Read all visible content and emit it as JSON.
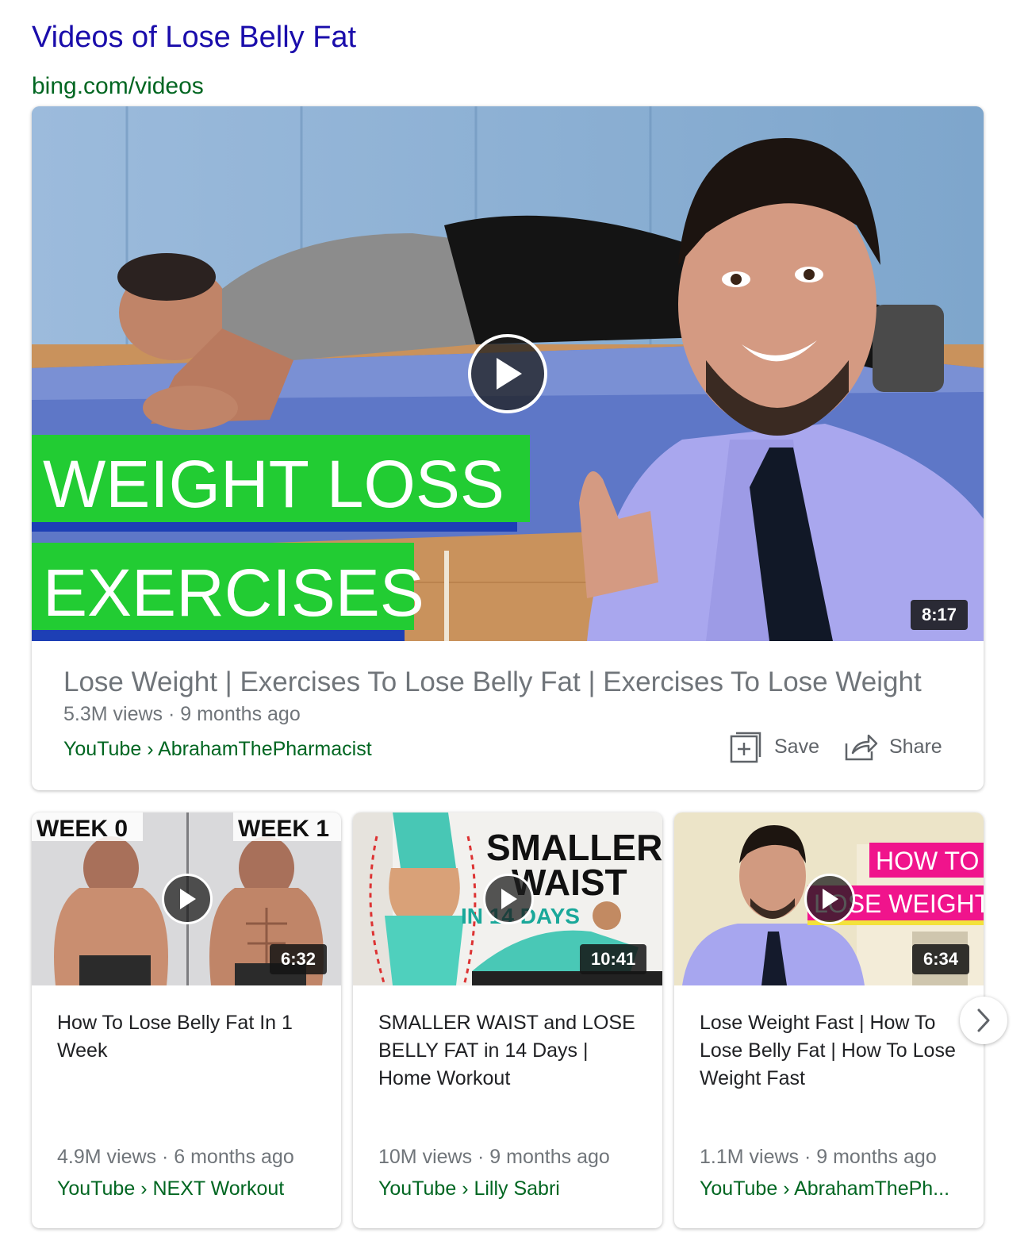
{
  "header": {
    "title": "Videos of Lose Belly Fat",
    "source": "bing.com/videos"
  },
  "featured": {
    "overlay_line1": "WEIGHT LOSS",
    "overlay_line2": "EXERCISES",
    "duration": "8:17",
    "title": "Lose Weight | Exercises To Lose Belly Fat | Exercises To Lose Weight",
    "meta": "5.3M views · 9 months ago",
    "source": "YouTube › AbrahamThePharmacist",
    "save_label": "Save",
    "share_label": "Share"
  },
  "videos": [
    {
      "overlay_left": "WEEK 0",
      "overlay_right": "WEEK 1",
      "duration": "6:32",
      "title": "How To Lose Belly Fat In 1 Week",
      "meta": "4.9M views · 6 months ago",
      "source": "YouTube › NEXT Workout"
    },
    {
      "overlay_line1": "SMALLER",
      "overlay_line2": "WAIST",
      "overlay_line3": "IN 14 DAYS",
      "duration": "10:41",
      "title": "SMALLER WAIST and LOSE BELLY FAT in 14 Days | Home Workout",
      "meta": "10M views · 9 months ago",
      "source": "YouTube › Lilly Sabri"
    },
    {
      "overlay_line1": "HOW TO",
      "overlay_line2": "LOSE WEIGHT",
      "duration": "6:34",
      "title": "Lose Weight Fast | How To Lose Belly Fat | How To Lose Weight Fast",
      "meta": "1.1M views · 9 months ago",
      "source": "YouTube › AbrahamThePh..."
    }
  ],
  "colors": {
    "link": "#1a0dab",
    "source_green": "#006621",
    "meta_gray": "#70757a",
    "overlay_green": "#22cc33",
    "overlay_pink": "#f0148c"
  }
}
